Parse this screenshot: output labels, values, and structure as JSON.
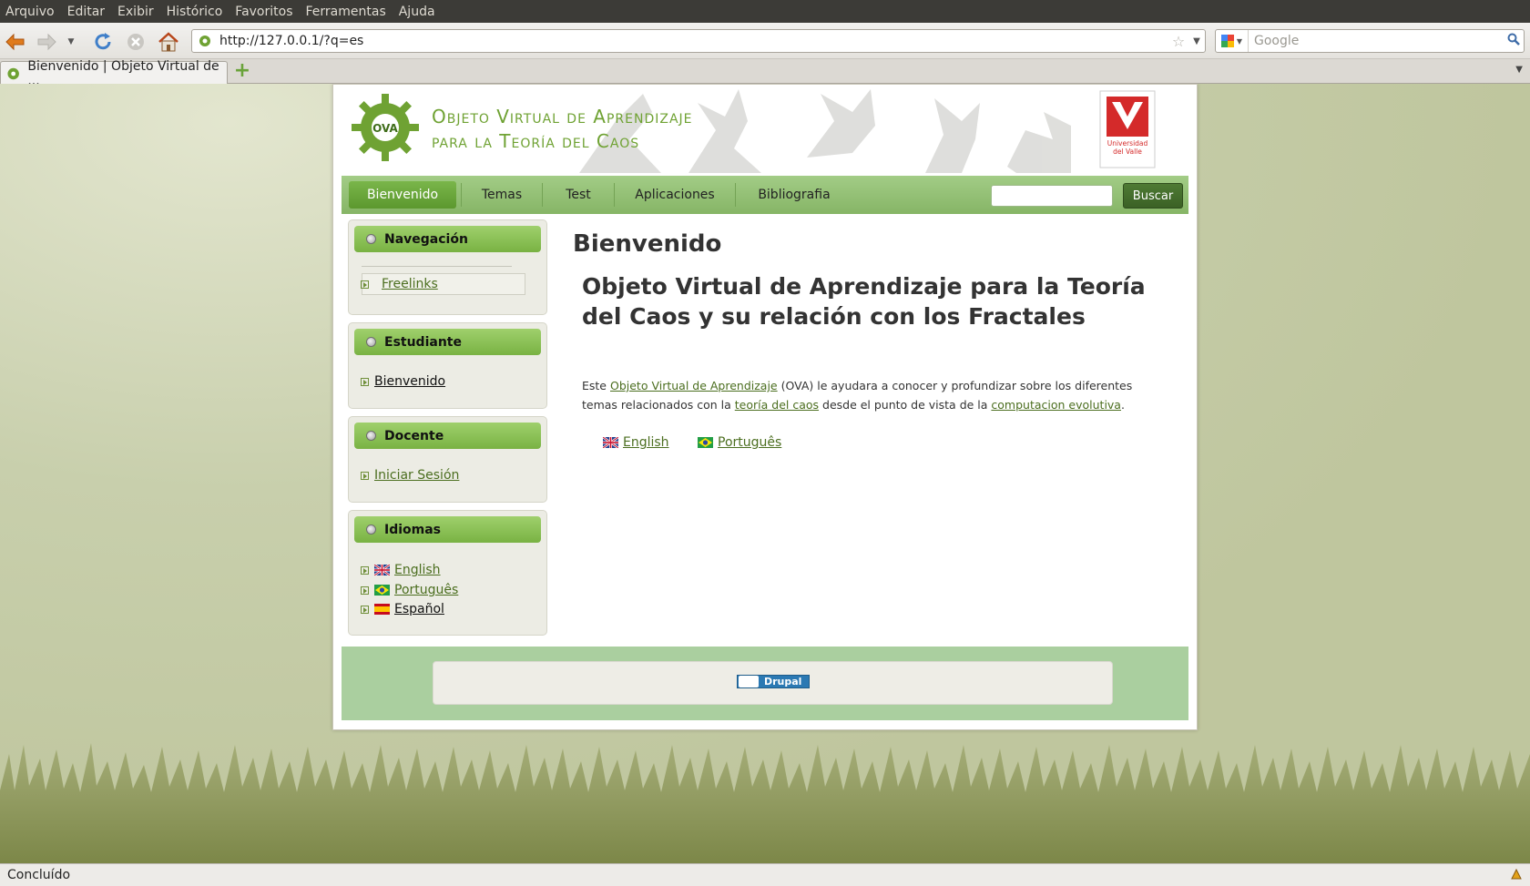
{
  "browser": {
    "menu": [
      "Arquivo",
      "Editar",
      "Exibir",
      "Histórico",
      "Favoritos",
      "Ferramentas",
      "Ajuda"
    ],
    "url": "http://127.0.0.1/?q=es",
    "search_placeholder": "Google",
    "tab_title": "Bienvenido | Objeto Virtual de ...",
    "status": "Concluído"
  },
  "site": {
    "name_line1": "Objeto Virtual de Aprendizaje",
    "name_line2": "para la Teoría del Caos",
    "gear_text": "OVA",
    "university_line1": "Universidad",
    "university_line2": "del Valle"
  },
  "nav": {
    "items": [
      "Bienvenido",
      "Temas",
      "Test",
      "Aplicaciones",
      "Bibliografia"
    ],
    "active": "Bienvenido",
    "search_button": "Buscar"
  },
  "sidebar": {
    "navegacion": {
      "title": "Navegación",
      "items": [
        "Freelinks"
      ]
    },
    "estudiante": {
      "title": "Estudiante",
      "items": [
        "Bienvenido"
      ]
    },
    "docente": {
      "title": "Docente",
      "items": [
        "Iniciar Sesión"
      ]
    },
    "idiomas": {
      "title": "Idiomas",
      "items": [
        "English",
        "Português",
        "Español"
      ]
    }
  },
  "content": {
    "title": "Bienvenido",
    "heading": "Objeto Virtual de Aprendizaje para la Teoría del Caos y su relación con los Fractales",
    "body": {
      "p1": "Este ",
      "link1": "Objeto Virtual de Aprendizaje",
      "p2": " (OVA) le ayudara a conocer y profundizar sobre los diferentes temas relacionados con la ",
      "link2": "teoría del caos",
      "p3": " desde el punto de vista de la ",
      "link3": "computacion evolutiva",
      "p4": "."
    },
    "languages": [
      "English",
      "Português"
    ]
  },
  "footer": {
    "badge": "Drupal"
  },
  "colors": {
    "nav_green": "#8ebc6e",
    "link_green": "#4b6e1f",
    "footer_green": "#aacf9f",
    "brand_red": "#d42a2a"
  }
}
